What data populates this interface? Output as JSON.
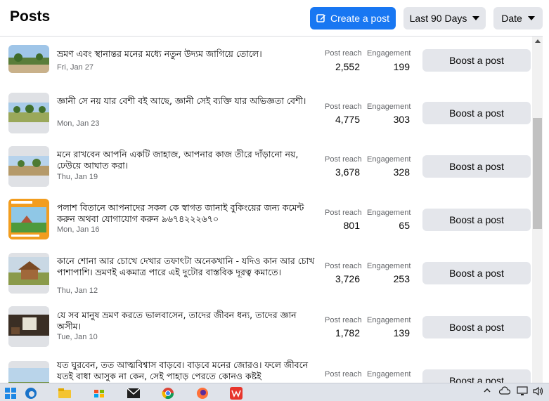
{
  "header": {
    "title": "Posts",
    "create_label": "Create a post",
    "range_label": "Last 90 Days",
    "sort_label": "Date"
  },
  "labels": {
    "reach": "Post reach",
    "engagement": "Engagement",
    "boost": "Boost a post"
  },
  "posts": [
    {
      "text": "ভ্রমণ এবং স্থানান্তর মনের মধ্যে নতুন উদ্যম জাগিয়ে তোলে।",
      "date": "Fri, Jan 27",
      "reach": "2,552",
      "engagement": "199",
      "thumb_icon": "landscape-photo-icon"
    },
    {
      "text": "জ্ঞানী সে নয় যার বেশী বই আছে, জ্ঞানী সেই ব্যক্তি যার অভিজ্ঞতা বেশী।",
      "date": "Mon, Jan 23",
      "reach": "4,775",
      "engagement": "303",
      "thumb_icon": "landscape-photo-icon"
    },
    {
      "text": "মনে রাখবেন আপনি একটি জাহাজ, আপনার কাজ তীরে দাঁড়ানো নয়, ঢেউয়ে আঘাত করা।",
      "date": "Thu, Jan 19",
      "reach": "3,678",
      "engagement": "328",
      "thumb_icon": "landscape-photo-icon"
    },
    {
      "text": "পলাশ বিতানে আপনাদের সকল কে স্বাগত জানাই বুকিংয়ের জন্য কমেন্ট করুন অথবা যোগাযোগ করুন ৯৬৭৪২২২৬৭০",
      "date": "Mon, Jan 16",
      "reach": "801",
      "engagement": "65",
      "thumb_icon": "resort-poster-icon"
    },
    {
      "text": "কানে শোনা আর চোখে দেখার তফাৎটা অনেকখানি - যদিও কান আর চোখ পাশাপাশি। ভ্রমণই একমাত্র পারে এই দুটোর বাস্তবিক দূরত্ব কমাতে।",
      "date": "Thu, Jan 12",
      "reach": "3,726",
      "engagement": "253",
      "thumb_icon": "cottage-photo-icon"
    },
    {
      "text": "যে সব মানুষ ভ্রমণ করতে ভালবাসেন, তাদের জীবন ধন্য, তাদের জ্ঞান অসীম।",
      "date": "Tue, Jan 10",
      "reach": "1,782",
      "engagement": "139",
      "thumb_icon": "room-photo-icon"
    },
    {
      "text": "যত ঘুরবেন, তত আত্মবিশ্বাস বাড়বে। বাড়বে মনের জোরও। ফলে জীবনে যতই বাধা আসুক না কেন, সেই পাহাড় পেরতে কোনও কষ্টই",
      "date": "",
      "reach": "",
      "engagement": "",
      "thumb_icon": "landscape-photo-icon"
    }
  ],
  "taskbar": {
    "icons": [
      "windows-start-icon",
      "edge-browser-icon",
      "file-explorer-icon",
      "microsoft-store-icon",
      "mail-icon",
      "chrome-icon",
      "firefox-icon",
      "wps-office-icon"
    ],
    "tray": [
      "chevron-up-icon",
      "onedrive-icon",
      "network-icon",
      "speaker-icon"
    ]
  },
  "colors": {
    "accent": "#1877f2",
    "button_gray": "#e4e6eb",
    "secondary_text": "#65676b"
  }
}
